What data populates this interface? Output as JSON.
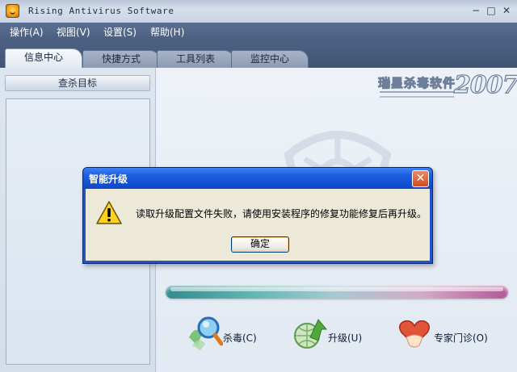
{
  "window": {
    "title": "Rising Antivirus Software",
    "controls": {
      "minimize": "−",
      "maximize": "□",
      "close": "✕"
    }
  },
  "menu": {
    "items": [
      {
        "label": "操作(A)"
      },
      {
        "label": "视图(V)"
      },
      {
        "label": "设置(S)"
      },
      {
        "label": "帮助(H)"
      }
    ]
  },
  "tabs": [
    {
      "label": "信息中心",
      "active": true
    },
    {
      "label": "快捷方式",
      "active": false
    },
    {
      "label": "工具列表",
      "active": false
    },
    {
      "label": "监控中心",
      "active": false
    }
  ],
  "sidebar": {
    "header": "查杀目标"
  },
  "brand": {
    "name": "瑞星杀毒软件",
    "year": "2007"
  },
  "actions": [
    {
      "label": "杀毒(C)",
      "icon": "scan-magnifier-icon"
    },
    {
      "label": "升级(U)",
      "icon": "upgrade-globe-icon"
    },
    {
      "label": "专家门诊(O)",
      "icon": "expert-clinic-icon"
    }
  ],
  "dialog": {
    "title": "智能升级",
    "close_glyph": "✕",
    "icon": "warning-icon",
    "message": "读取升级配置文件失败，请使用安装程序的修复功能修复后再升级。",
    "ok_label": "确定"
  },
  "colors": {
    "menu_bar": "#4b5f80",
    "dialog_title": "#0e46c9",
    "dialog_body": "#ece9d8",
    "progress_start": "#2f8d8f",
    "progress_end": "#b55897"
  }
}
